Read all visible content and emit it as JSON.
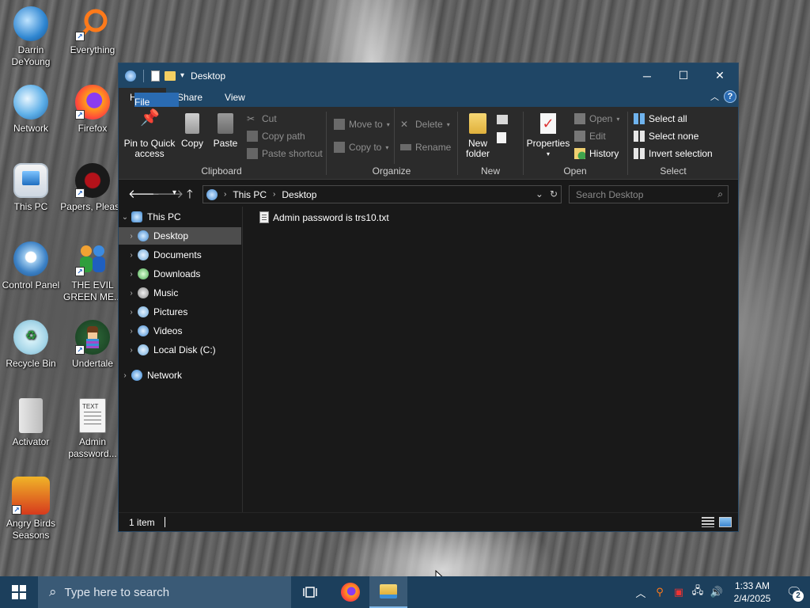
{
  "desktop": {
    "icons": [
      {
        "label": "Darrin DeYoung",
        "icon": "user-globe-icon"
      },
      {
        "label": "Everything",
        "icon": "everything-search-icon"
      },
      {
        "label": "Network",
        "icon": "network-icon"
      },
      {
        "label": "Firefox",
        "icon": "firefox-icon"
      },
      {
        "label": "This PC",
        "icon": "computer-icon"
      },
      {
        "label": "Papers, Please",
        "icon": "papers-please-icon"
      },
      {
        "label": "Control Panel",
        "icon": "control-panel-icon"
      },
      {
        "label": "THE EVIL GREEN ME...",
        "icon": "people-icon"
      },
      {
        "label": "Recycle Bin",
        "icon": "recycle-bin-icon"
      },
      {
        "label": "Undertale",
        "icon": "undertale-icon"
      },
      {
        "label": "Activator",
        "icon": "folder-icon"
      },
      {
        "label": "Admin password...",
        "icon": "text-file-icon"
      },
      {
        "label": "Angry Birds Seasons",
        "icon": "angry-birds-icon"
      }
    ]
  },
  "window": {
    "title": "Desktop",
    "tabs": {
      "file": "File",
      "home": "Home",
      "share": "Share",
      "view": "View"
    },
    "ribbon": {
      "clipboard": {
        "label": "Clipboard",
        "pin": "Pin to Quick access",
        "copy": "Copy",
        "paste": "Paste",
        "cut": "Cut",
        "copy_path": "Copy path",
        "paste_shortcut": "Paste shortcut"
      },
      "organize": {
        "label": "Organize",
        "move_to": "Move to",
        "copy_to": "Copy to",
        "delete": "Delete",
        "rename": "Rename"
      },
      "new": {
        "label": "New",
        "new_folder": "New folder"
      },
      "open": {
        "label": "Open",
        "properties": "Properties",
        "open": "Open",
        "edit": "Edit",
        "history": "History"
      },
      "select": {
        "label": "Select",
        "select_all": "Select all",
        "select_none": "Select none",
        "invert": "Invert selection"
      }
    },
    "address": {
      "root": "This PC",
      "current": "Desktop"
    },
    "search_placeholder": "Search Desktop",
    "nav": {
      "this_pc": "This PC",
      "items": [
        "Desktop",
        "Documents",
        "Downloads",
        "Music",
        "Pictures",
        "Videos",
        "Local Disk (C:)"
      ],
      "network": "Network"
    },
    "files": [
      "Admin password is trs10.txt"
    ],
    "status": "1 item"
  },
  "taskbar": {
    "search_placeholder": "Type here to search",
    "time": "1:33 AM",
    "date": "2/4/2025",
    "notifications": "2"
  },
  "colors": {
    "titlebar": "#1f4666",
    "file_tab": "#2a6bb2",
    "taskbar": "#1c3f5c"
  }
}
